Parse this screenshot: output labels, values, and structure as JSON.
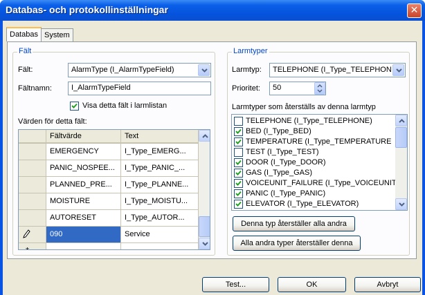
{
  "window": {
    "title": "Databas- och protokollinställningar",
    "close_glyph": "✕"
  },
  "tabs": [
    {
      "label": "Databas"
    },
    {
      "label": "System"
    }
  ],
  "falt_group": {
    "legend": "Fält",
    "field_label": "Fält:",
    "field_value": "AlarmType (I_AlarmTypeField)",
    "name_label": "Fältnamn:",
    "name_value": "I_AlarmTypeField",
    "show_in_list_label": "Visa detta fält i larmlistan",
    "show_in_list_checked": true,
    "values_label": "Värden för detta fält:",
    "grid": {
      "headers": [
        "Fältvärde",
        "Text"
      ],
      "rows": [
        {
          "value": "EMERGENCY",
          "text": "I_Type_EMERG..."
        },
        {
          "value": "PANIC_NOSPEE...",
          "text": "I_Type_PANIC_..."
        },
        {
          "value": "PLANNED_PRE...",
          "text": "I_Type_PLANNE..."
        },
        {
          "value": "MOISTURE",
          "text": "I_Type_MOISTU..."
        },
        {
          "value": "AUTORESET",
          "text": "I_Type_AUTOR..."
        },
        {
          "value": "090",
          "text": "Service",
          "selected": true,
          "editing": true
        }
      ],
      "new_row_marker": "*",
      "edit_marker_icon": "pencil-icon"
    }
  },
  "larmtyper_group": {
    "legend": "Larmtyper",
    "type_label": "Larmtyp:",
    "type_value": "TELEPHONE (I_Type_TELEPHONE",
    "priority_label": "Prioritet:",
    "priority_value": "50",
    "reset_list_label": "Larmtyper som återställs av denna larmtyp",
    "reset_list": [
      {
        "label": "TELEPHONE (I_Type_TELEPHONE)",
        "checked": false
      },
      {
        "label": "BED (I_Type_BED)",
        "checked": true
      },
      {
        "label": "TEMPERATURE (I_Type_TEMPERATURE",
        "checked": true
      },
      {
        "label": "TEST (I_Type_TEST)",
        "checked": false
      },
      {
        "label": "DOOR (I_Type_DOOR)",
        "checked": true
      },
      {
        "label": "GAS (I_Type_GAS)",
        "checked": true
      },
      {
        "label": "VOICEUNIT_FAILURE (I_Type_VOICEUNIT",
        "checked": true
      },
      {
        "label": "PANIC (I_Type_PANIC)",
        "checked": true
      },
      {
        "label": "ELEVATOR (I_Type_ELEVATOR)",
        "checked": true
      }
    ],
    "reset_all_others_button": "Denna typ återställer alla andra",
    "all_others_reset_button": "Alla andra typer återställer denna"
  },
  "footer": {
    "test_button": "Test...",
    "ok_button": "OK",
    "cancel_button": "Avbryt"
  },
  "colors": {
    "title_bar": "#0553dc",
    "dialog_bg": "#ece9d8",
    "group_legend": "#0046d5",
    "selection": "#316ac5",
    "check_mark": "#21a121"
  }
}
